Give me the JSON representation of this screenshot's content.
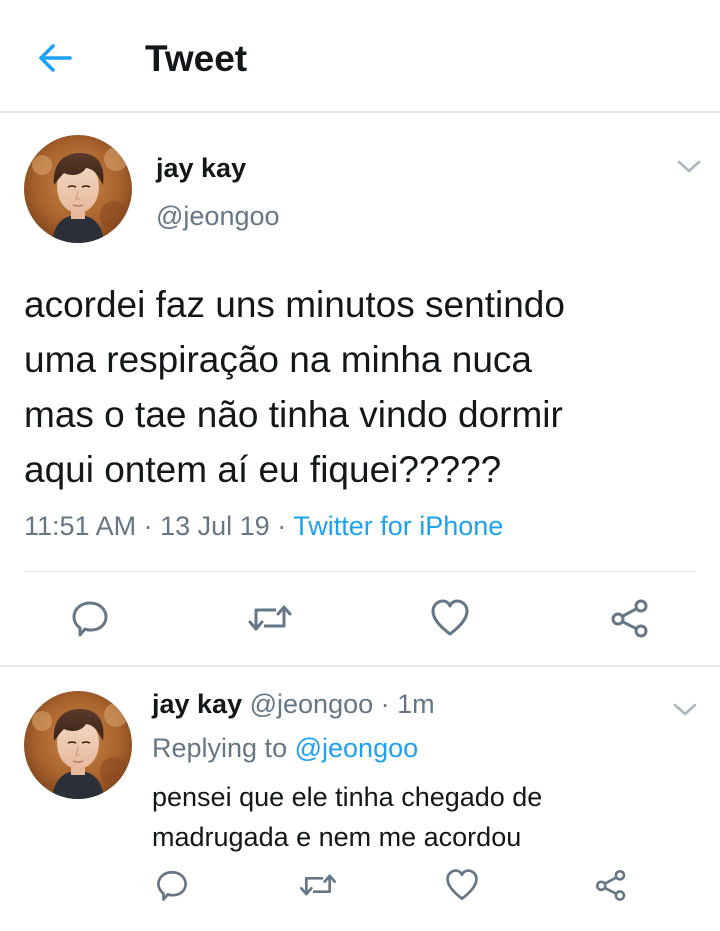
{
  "header": {
    "title": "Tweet",
    "back_icon": "arrow-left-icon",
    "accent": "#1da1f2"
  },
  "tweet": {
    "name": "jay kay",
    "handle": "@jeongoo",
    "text_lines": [
      "acordei faz uns minutos sentindo",
      "uma respiração na minha nuca",
      "mas o tae não tinha vindo dormir",
      "aqui ontem aí eu fiquei?????"
    ],
    "time": "11:51 AM",
    "date": "13 Jul 19",
    "separator": "·",
    "source": "Twitter for iPhone",
    "actions": [
      "reply-icon",
      "retweet-icon",
      "like-icon",
      "share-icon"
    ]
  },
  "reply": {
    "name": "jay kay",
    "handle": "@jeongoo",
    "separator": "·",
    "time": "1m",
    "replying_label": "Replying to",
    "replying_to": "@jeongoo",
    "text_lines": [
      "pensei que ele tinha chegado de",
      "madrugada e nem me acordou"
    ]
  },
  "colors": {
    "text": "#14171a",
    "secondary": "#657786",
    "link": "#1da1f2",
    "divider": "#e1e8ed"
  }
}
